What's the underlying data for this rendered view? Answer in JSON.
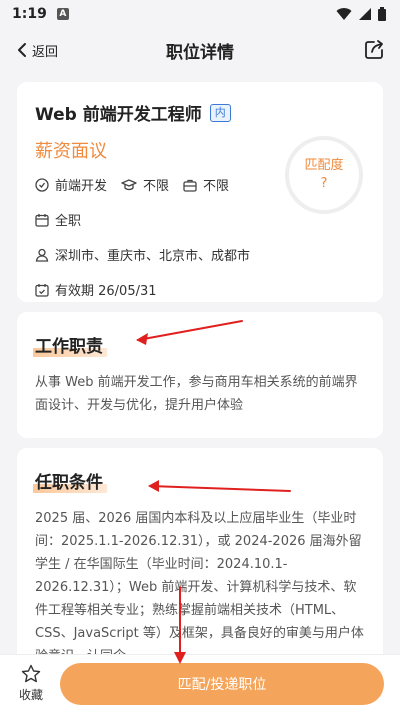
{
  "status": {
    "time": "1:19",
    "badge": "A"
  },
  "nav": {
    "back_label": "返回",
    "title": "职位详情"
  },
  "job": {
    "title": "Web 前端开发工程师",
    "tag": "内",
    "salary": "薪资面议",
    "category": "前端开发",
    "education": "不限",
    "experience": "不限",
    "job_type": "全职",
    "locations": "深圳市、重庆市、北京市、成都市",
    "valid_until": "有效期 26/05/31",
    "match_label": "匹配度",
    "match_value": "?"
  },
  "duties": {
    "heading": "工作职责",
    "text": "从事 Web 前端开发工作，参与商用车相关系统的前端界面设计、开发与优化，提升用户体验"
  },
  "requirements": {
    "heading": "任职条件",
    "text": "2025 届、2026 届国内本科及以上应届毕业生（毕业时间：2025.1.1-2026.12.31），或 2024-2026 届海外留学生 / 在华国际生（毕业时间：2024.10.1-2026.12.31）；Web 前端开发、计算机科学与技术、软件工程等相关专业；熟练掌握前端相关技术（HTML、CSS、JavaScript 等）及框架，具备良好的审美与用户体验意识，认同企"
  },
  "bottom": {
    "fav_label": "收藏",
    "apply_label": "匹配/投递职位"
  },
  "colors": {
    "accent": "#f08a3c",
    "button": "#f5a55b",
    "annotation_red": "#e0201e",
    "tag_blue": "#3b7bd6"
  }
}
